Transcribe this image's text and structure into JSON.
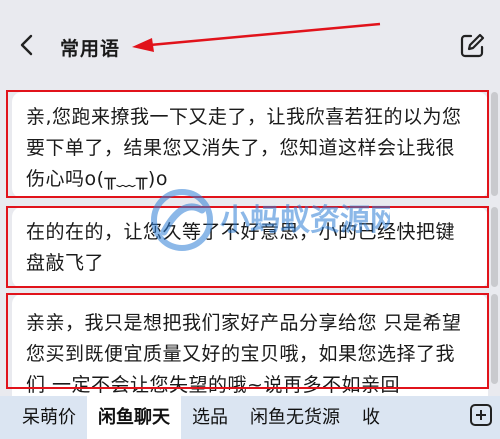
{
  "header": {
    "title": "常用语"
  },
  "phrases": [
    {
      "text": "亲,您跑来撩我一下又走了，让我欣喜若狂的以为您要下单了，结果您又消失了，您知道这样会让我很伤心吗o(╥﹏╥)o"
    },
    {
      "text": "在的在的，让您久等了不好意思，小的已经快把键盘敲飞了"
    },
    {
      "text": "亲亲，我只是想把我们家好产品分享给您 只是希望您买到既便宜质量又好的宝贝哦，如果您选择了我们 一定不会让您失望的哦~说再多不如亲回"
    }
  ],
  "watermark": {
    "text": "小蚂蚁资源网"
  },
  "tabs": [
    {
      "label": "呆萌价"
    },
    {
      "label": "闲鱼聊天"
    },
    {
      "label": "选品"
    },
    {
      "label": "闲鱼无货源"
    },
    {
      "label": "收"
    }
  ],
  "colors": {
    "highlight": "#e1131b",
    "tabbar": "#dbe5f2",
    "background": "#e9eaef"
  }
}
